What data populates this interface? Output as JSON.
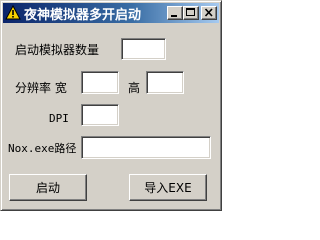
{
  "window": {
    "title": "夜神模拟器多开启动",
    "icon": "warning-triangle-icon",
    "title_gradient": [
      "#0a246a",
      "#a6caf0"
    ],
    "face_color": "#d4d0c8"
  },
  "titlebar_buttons": {
    "minimize": "minimize-icon",
    "maximize": "maximize-icon",
    "close": "close-icon"
  },
  "form": {
    "count_label": "启动模拟器数量",
    "count_value": "",
    "resolution_label": "分辨率 宽",
    "width_value": "",
    "height_label": "高",
    "height_value": "",
    "dpi_label": "DPI",
    "dpi_value": "",
    "path_label": "Nox.exe路径",
    "path_value": ""
  },
  "buttons": {
    "start_label": "启动",
    "import_label": "导入EXE"
  }
}
